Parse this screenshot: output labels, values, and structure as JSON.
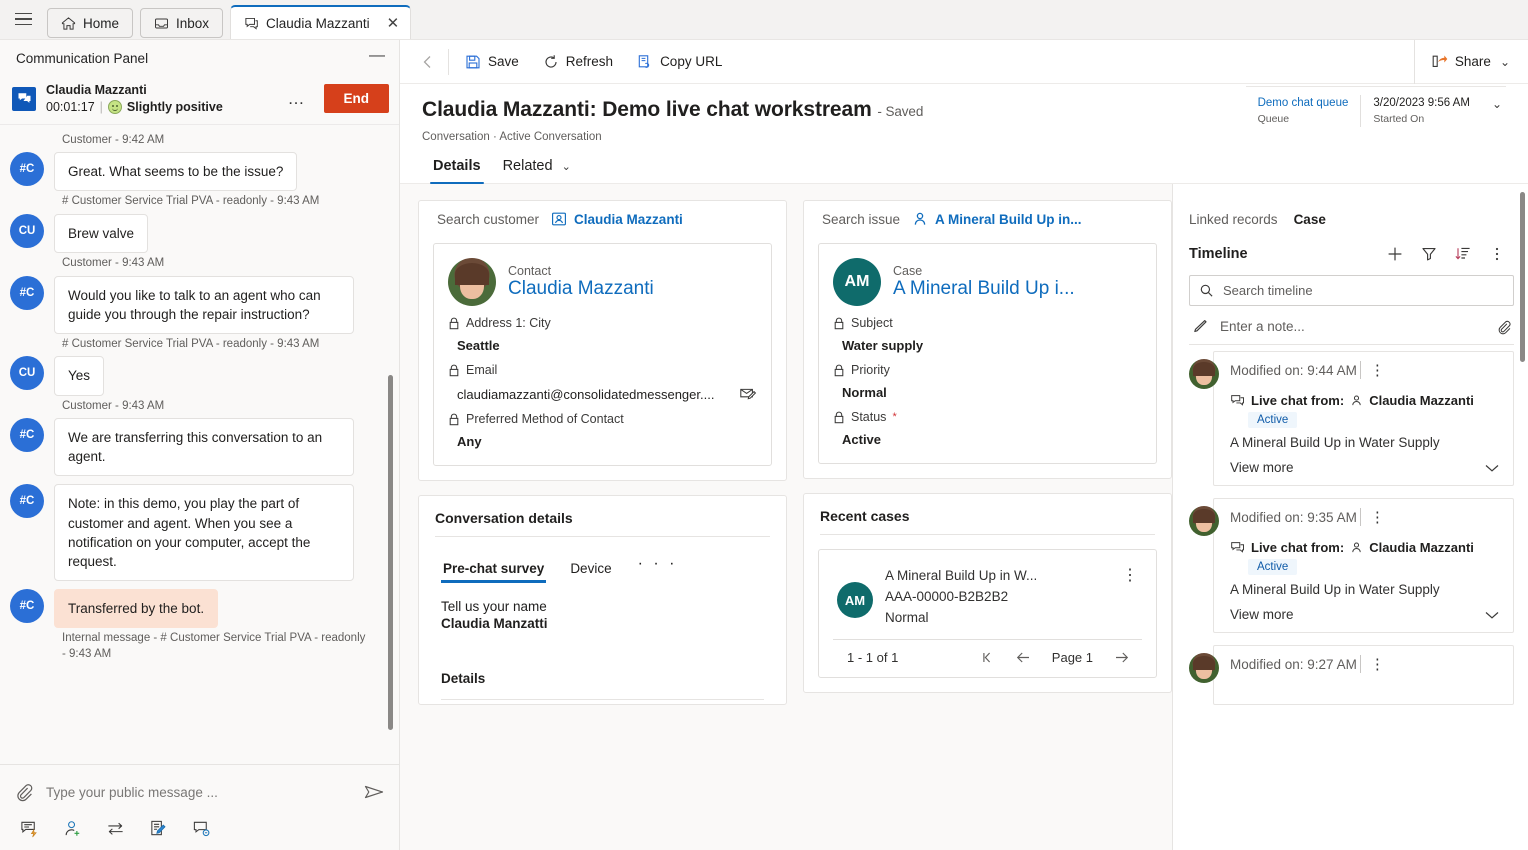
{
  "tabstrip": {
    "menu_icon": "hamburger-icon",
    "tabs": [
      {
        "label": "Home",
        "icon": "home-icon",
        "active": false
      },
      {
        "label": "Inbox",
        "icon": "inbox-icon",
        "active": false
      },
      {
        "label": "Claudia Mazzanti",
        "icon": "chat-icon",
        "active": true,
        "close": "✕"
      }
    ]
  },
  "communication_panel": {
    "title": "Communication Panel",
    "minimize_label": "—",
    "session": {
      "name": "Claudia Mazzanti",
      "timer": "00:01:17",
      "separator": "|",
      "sentiment": "Slightly positive",
      "sentiment_icon": "smiley-icon",
      "more_label": "…",
      "end_label": "End",
      "end_color": "#d6401b"
    },
    "messages": [
      {
        "type": "meta",
        "text": "Customer - 9:42 AM"
      },
      {
        "type": "bubble",
        "avatar": "#C",
        "avatar_color": "#2b6fd6",
        "text": "Great. What seems to be the issue?",
        "internal": false
      },
      {
        "type": "meta",
        "text": "# Customer Service Trial PVA - readonly - 9:43 AM"
      },
      {
        "type": "bubble",
        "avatar": "CU",
        "avatar_color": "#2b6fd6",
        "text": "Brew valve",
        "internal": false
      },
      {
        "type": "meta",
        "text": "Customer - 9:43 AM"
      },
      {
        "type": "bubble",
        "avatar": "#C",
        "avatar_color": "#2b6fd6",
        "text": "Would you like to talk to an agent who can guide you through the repair instruction?",
        "internal": false
      },
      {
        "type": "meta",
        "text": "# Customer Service Trial PVA - readonly - 9:43 AM"
      },
      {
        "type": "bubble",
        "avatar": "CU",
        "avatar_color": "#2b6fd6",
        "text": "Yes",
        "internal": false
      },
      {
        "type": "meta",
        "text": "Customer - 9:43 AM"
      },
      {
        "type": "bubble",
        "avatar": "#C",
        "avatar_color": "#2b6fd6",
        "text": "We are transferring this conversation to an agent.",
        "internal": false
      },
      {
        "type": "bubble",
        "avatar": "#C",
        "avatar_color": "#2b6fd6",
        "text": "Note: in this demo, you play the part of customer and agent. When you see a notification on your computer, accept the request.",
        "internal": false
      },
      {
        "type": "bubble",
        "avatar": "#C",
        "avatar_color": "#2b6fd6",
        "text": "Transferred by the bot.",
        "internal": true
      },
      {
        "type": "meta",
        "text": "Internal message - # Customer Service Trial PVA - readonly - 9:43 AM"
      }
    ],
    "compose": {
      "attach_icon": "paperclip-icon",
      "placeholder": "Type your public message ...",
      "send_icon": "send-icon"
    },
    "tools": [
      {
        "name": "quick-reply-icon"
      },
      {
        "name": "add-participant-icon"
      },
      {
        "name": "transfer-icon"
      },
      {
        "name": "notes-icon"
      },
      {
        "name": "consult-icon"
      }
    ]
  },
  "command_bar": {
    "back_icon": "back-arrow-icon",
    "buttons": [
      {
        "label": "Save",
        "icon": "save-icon"
      },
      {
        "label": "Refresh",
        "icon": "refresh-icon"
      },
      {
        "label": "Copy URL",
        "icon": "copy-url-icon"
      }
    ],
    "share": {
      "label": "Share",
      "icon": "share-icon",
      "chevron": "⌄"
    }
  },
  "record_header": {
    "title": "Claudia Mazzanti: Demo live chat workstream",
    "saved_state": "- Saved",
    "breadcrumb": "Conversation · Active Conversation",
    "fields": [
      {
        "value": "Demo chat queue",
        "label": "Queue",
        "link": true
      },
      {
        "value": "3/20/2023 9:56 AM",
        "label": "Started On",
        "link": false
      }
    ],
    "chevron": "⌄"
  },
  "page_tabs": [
    {
      "label": "Details",
      "active": true,
      "chevron": ""
    },
    {
      "label": "Related",
      "active": false,
      "chevron": "⌄"
    }
  ],
  "customer_column": {
    "lookup": {
      "label": "Search customer",
      "value": "Claudia Mazzanti",
      "icon": "contact-icon"
    },
    "card": {
      "type": "Contact",
      "name": "Claudia Mazzanti",
      "avatar": "contact-photo",
      "fields": [
        {
          "label": "Address 1: City",
          "value": "Seattle",
          "lock_icon": "lock-icon",
          "required": false
        },
        {
          "label": "Email",
          "value": "claudiamazzanti@consolidatedmessenger....",
          "lock_icon": "lock-icon",
          "required": false,
          "action_icon": "email-icon"
        },
        {
          "label": "Preferred Method of Contact",
          "value": "Any",
          "lock_icon": "lock-icon",
          "required": false
        }
      ]
    },
    "conversation_details": {
      "title": "Conversation details",
      "tabs": [
        {
          "label": "Pre-chat survey",
          "active": true
        },
        {
          "label": "Device",
          "active": false
        },
        {
          "label": "· · ·",
          "active": false,
          "is_overflow": true
        }
      ],
      "survey": [
        {
          "question": "Tell us your name",
          "answer": "Claudia Manzatti"
        }
      ],
      "details_label": "Details"
    }
  },
  "issue_column": {
    "lookup": {
      "label": "Search issue",
      "value": "A Mineral Build Up in...",
      "icon": "contact-icon"
    },
    "card": {
      "type": "Case",
      "initials": "AM",
      "initials_color": "#0f6b6b",
      "name": "A Mineral Build Up i...",
      "fields": [
        {
          "label": "Subject",
          "value": "Water supply",
          "lock_icon": "lock-icon",
          "required": false
        },
        {
          "label": "Priority",
          "value": "Normal",
          "lock_icon": "lock-icon",
          "required": false
        },
        {
          "label": "Status",
          "value": "Active",
          "lock_icon": "lock-icon",
          "required": true
        }
      ]
    },
    "recent_cases": {
      "title": "Recent cases",
      "items": [
        {
          "initials": "AM",
          "title": "A Mineral Build Up in W...",
          "number": "AAA-00000-B2B2B2",
          "priority": "Normal",
          "more": "⋮"
        }
      ],
      "footer": {
        "count": "1 - 1 of 1",
        "first_icon": "first-page-icon",
        "prev_icon": "prev-page-icon",
        "page_label": "Page 1",
        "next_icon": "next-page-icon"
      }
    }
  },
  "right_pane": {
    "linked_records": {
      "label": "Linked records",
      "value": "Case"
    },
    "timeline": {
      "title": "Timeline",
      "actions": [
        {
          "name": "add-record-icon",
          "glyph": "+"
        },
        {
          "name": "filter-icon",
          "glyph": "∇"
        },
        {
          "name": "sort-icon",
          "glyph": "↓"
        },
        {
          "name": "more-commands-icon",
          "glyph": "⋮"
        }
      ],
      "search_placeholder": "Search timeline",
      "search_icon": "search-icon",
      "note": {
        "icon": "pencil-icon",
        "placeholder": "Enter a note...",
        "attach_icon": "paperclip-icon"
      },
      "items": [
        {
          "modified": "Modified on: 9:44 AM",
          "more": "⋮",
          "source_icon": "chat-icon",
          "source_prefix": "Live chat from:",
          "source_person_icon": "person-icon",
          "source_person": "Claudia Mazzanti",
          "badge": "Active",
          "description": "A Mineral Build Up in Water Supply",
          "view_more": "View more",
          "chevron": "⌄"
        },
        {
          "modified": "Modified on: 9:35 AM",
          "more": "⋮",
          "source_icon": "chat-icon",
          "source_prefix": "Live chat from:",
          "source_person_icon": "person-icon",
          "source_person": "Claudia Mazzanti",
          "badge": "Active",
          "description": "A Mineral Build Up in Water Supply",
          "view_more": "View more",
          "chevron": "⌄"
        },
        {
          "modified": "Modified on: 9:27 AM",
          "more": "⋮",
          "source_icon": "chat-icon",
          "source_prefix": "",
          "source_person_icon": "",
          "source_person": "",
          "badge": "",
          "description": "",
          "view_more": "",
          "chevron": ""
        }
      ]
    }
  }
}
